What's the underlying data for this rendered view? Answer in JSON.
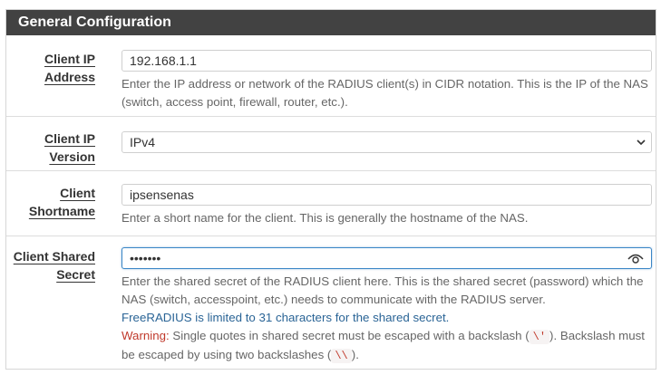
{
  "panel": {
    "title": "General Configuration"
  },
  "client_ip": {
    "label_line1": "Client IP",
    "label_line2": "Address",
    "value": "192.168.1.1",
    "help": "Enter the IP address or network of the RADIUS client(s) in CIDR notation. This is the IP of the NAS (switch, access point, firewall, router, etc.)."
  },
  "ip_version": {
    "label_line1": "Client IP",
    "label_line2": "Version",
    "selected": "IPv4"
  },
  "shortname": {
    "label_line1": "Client",
    "label_line2": "Shortname",
    "value": "ipsensenas",
    "help": "Enter a short name for the client. This is generally the hostname of the NAS."
  },
  "shared_secret": {
    "label_line1": "Client Shared",
    "label_line2": "Secret",
    "value": "•••••••",
    "help1": "Enter the shared secret of the RADIUS client here. This is the shared secret (password) which the NAS (switch, accesspoint, etc.) needs to communicate with the RADIUS server.",
    "help2": "FreeRADIUS is limited to 31 characters for the shared secret.",
    "warning_label": "Warning:",
    "warning_text_a": " Single quotes in shared secret must be escaped with a backslash (",
    "code1": "\\'",
    "warning_text_b": "). Backslash must be escaped by using two backslashes (",
    "code2": "\\\\",
    "warning_text_c": ")."
  },
  "icons": {
    "select": "chevron-down-icon",
    "reveal": "eye-icon"
  },
  "colors": {
    "header_bg": "#424242",
    "focus_border": "#3b86c6",
    "warning": "#c0392b",
    "info": "#2a6496"
  }
}
